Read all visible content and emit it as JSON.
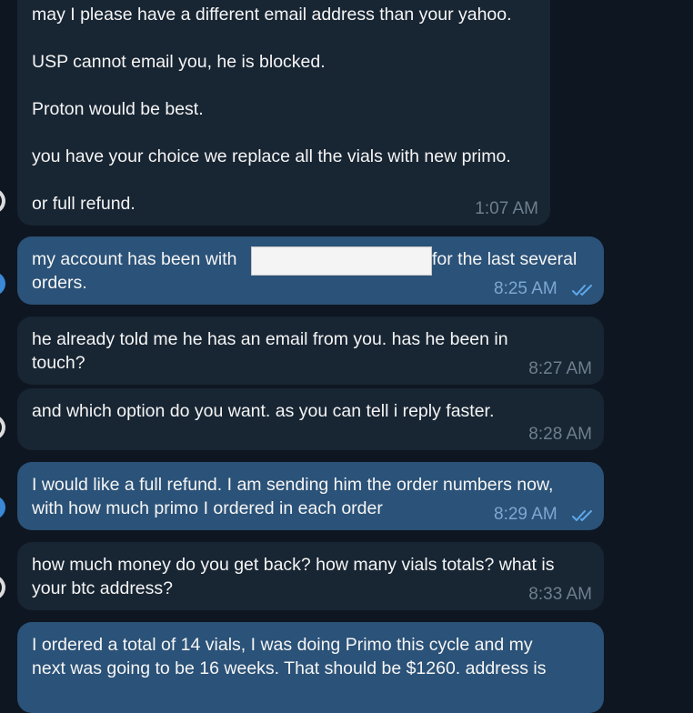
{
  "messages": [
    {
      "direction": "incoming",
      "lines": [
        "may I please have a different email address than your yahoo.",
        "USP cannot email you, he is blocked.",
        "Proton would be best.",
        "you have your choice we replace all the vials with new primo.",
        "or full refund."
      ],
      "time": "1:07 AM"
    },
    {
      "direction": "outgoing",
      "lines": [
        "my account has been with",
        "for the last several",
        "orders."
      ],
      "redacted": true,
      "time": "8:25 AM",
      "status": "read"
    },
    {
      "direction": "incoming",
      "lines": [
        "he already told me he has an email from you.  has he been in",
        "touch?"
      ],
      "time": "8:27 AM"
    },
    {
      "direction": "incoming",
      "lines": [
        "and which option do you want.  as you can tell i reply faster."
      ],
      "time": "8:28 AM"
    },
    {
      "direction": "outgoing",
      "lines": [
        "I would like a full refund. I am sending him the order numbers now,",
        "with how much primo I ordered in each order"
      ],
      "time": "8:29 AM",
      "status": "read"
    },
    {
      "direction": "incoming",
      "lines": [
        "how much money do you get back?  how many vials totals? what is",
        "your btc address?"
      ],
      "time": "8:33 AM"
    },
    {
      "direction": "outgoing",
      "lines": [
        "I ordered a total of 14 vials, I was doing Primo this cycle and my",
        "next was going to be 16 weeks. That should be $1260.  address is"
      ]
    }
  ],
  "icons": {
    "read_receipt": "double-check-icon",
    "incoming_avatar": "avatar-icon",
    "outgoing_avatar": "avatar-icon"
  },
  "colors": {
    "background": "#0e1621",
    "incoming_bubble": "#182533",
    "outgoing_bubble": "#2b5278",
    "incoming_time": "#6d7f8f",
    "outgoing_time": "#7da8d3",
    "read_check": "#5ea7ea"
  }
}
